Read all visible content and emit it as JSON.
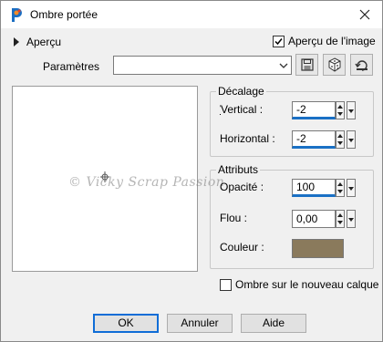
{
  "window": {
    "title": "Ombre portée"
  },
  "preview": {
    "toggle_label": "Aperçu",
    "image_preview_label": "Aperçu de l'image",
    "image_preview_checked": true,
    "watermark": "© Vicky Scrap Passion"
  },
  "params": {
    "label": "Paramètres",
    "value": ""
  },
  "decalage": {
    "title": "Décalage",
    "vertical_label": "Vertical :",
    "vertical_value": "-2",
    "horizontal_label": "Horizontal :",
    "horizontal_value": "-2"
  },
  "attributs": {
    "title": "Attributs",
    "opacite_label": "Opacité :",
    "opacite_value": "100",
    "flou_label": "Flou :",
    "flou_value": "0,00",
    "couleur_label": "Couleur :",
    "couleur_value": "#8a7a5c"
  },
  "ombre_calque": {
    "label": "Ombre sur le nouveau calque",
    "checked": false
  },
  "buttons": {
    "ok": "OK",
    "annuler": "Annuler",
    "aide": "Aide"
  },
  "colors": {
    "accent": "#1a70c5",
    "shadow_color": "#8a7a5c"
  }
}
